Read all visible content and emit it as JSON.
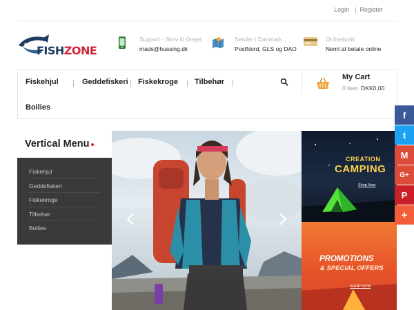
{
  "topbar": {
    "login": "Login",
    "separator": "|",
    "register": "Register"
  },
  "logo": {
    "part1": "FISH",
    "part2": "ZONE"
  },
  "info": [
    {
      "icon": "phone-icon",
      "label": "Support - Skriv til Grejet",
      "value": "mads@hussing.dk"
    },
    {
      "icon": "map-icon",
      "label": "Sender i Danmark",
      "value": "PostNord, GLS og DAO"
    },
    {
      "icon": "card-icon",
      "label": "Onlinebutik",
      "value": "Nemt at betale online"
    }
  ],
  "nav": {
    "items": [
      "Fiskehjul",
      "Geddefiskeri",
      "Fiskekroge",
      "Tilbehør",
      "Boilies"
    ],
    "search_icon": "search-icon"
  },
  "cart": {
    "title": "My Cart",
    "count": "0 item",
    "amount": "DKK0,00"
  },
  "vertical_menu": {
    "title": "Vertical Menu",
    "items": [
      "Fiskehjul",
      "Geddefiskeri",
      "Fiskekroge",
      "Tilbehør",
      "Boilies"
    ]
  },
  "banners": {
    "camping": {
      "line1": "CREATION",
      "line2": "CAMPING",
      "cta": "Shop Now"
    },
    "promo": {
      "line1": "PROMOTIONS",
      "line2": "& SPECIAL OFFERS",
      "cta": "SHOP NOW"
    }
  },
  "social": [
    {
      "name": "facebook",
      "glyph": "f",
      "color": "#3b5998"
    },
    {
      "name": "twitter",
      "glyph": "t",
      "color": "#1da1f2"
    },
    {
      "name": "gmail",
      "glyph": "M",
      "color": "#dd4b39"
    },
    {
      "name": "google-plus",
      "glyph": "G+",
      "color": "#dd4b39"
    },
    {
      "name": "pinterest",
      "glyph": "P",
      "color": "#cb2027"
    },
    {
      "name": "more",
      "glyph": "+",
      "color": "#f25d3a"
    }
  ],
  "colors": {
    "accent": "#e2262f",
    "dark_panel": "#3a3a3a",
    "cart_icon": "#f2a33a"
  }
}
